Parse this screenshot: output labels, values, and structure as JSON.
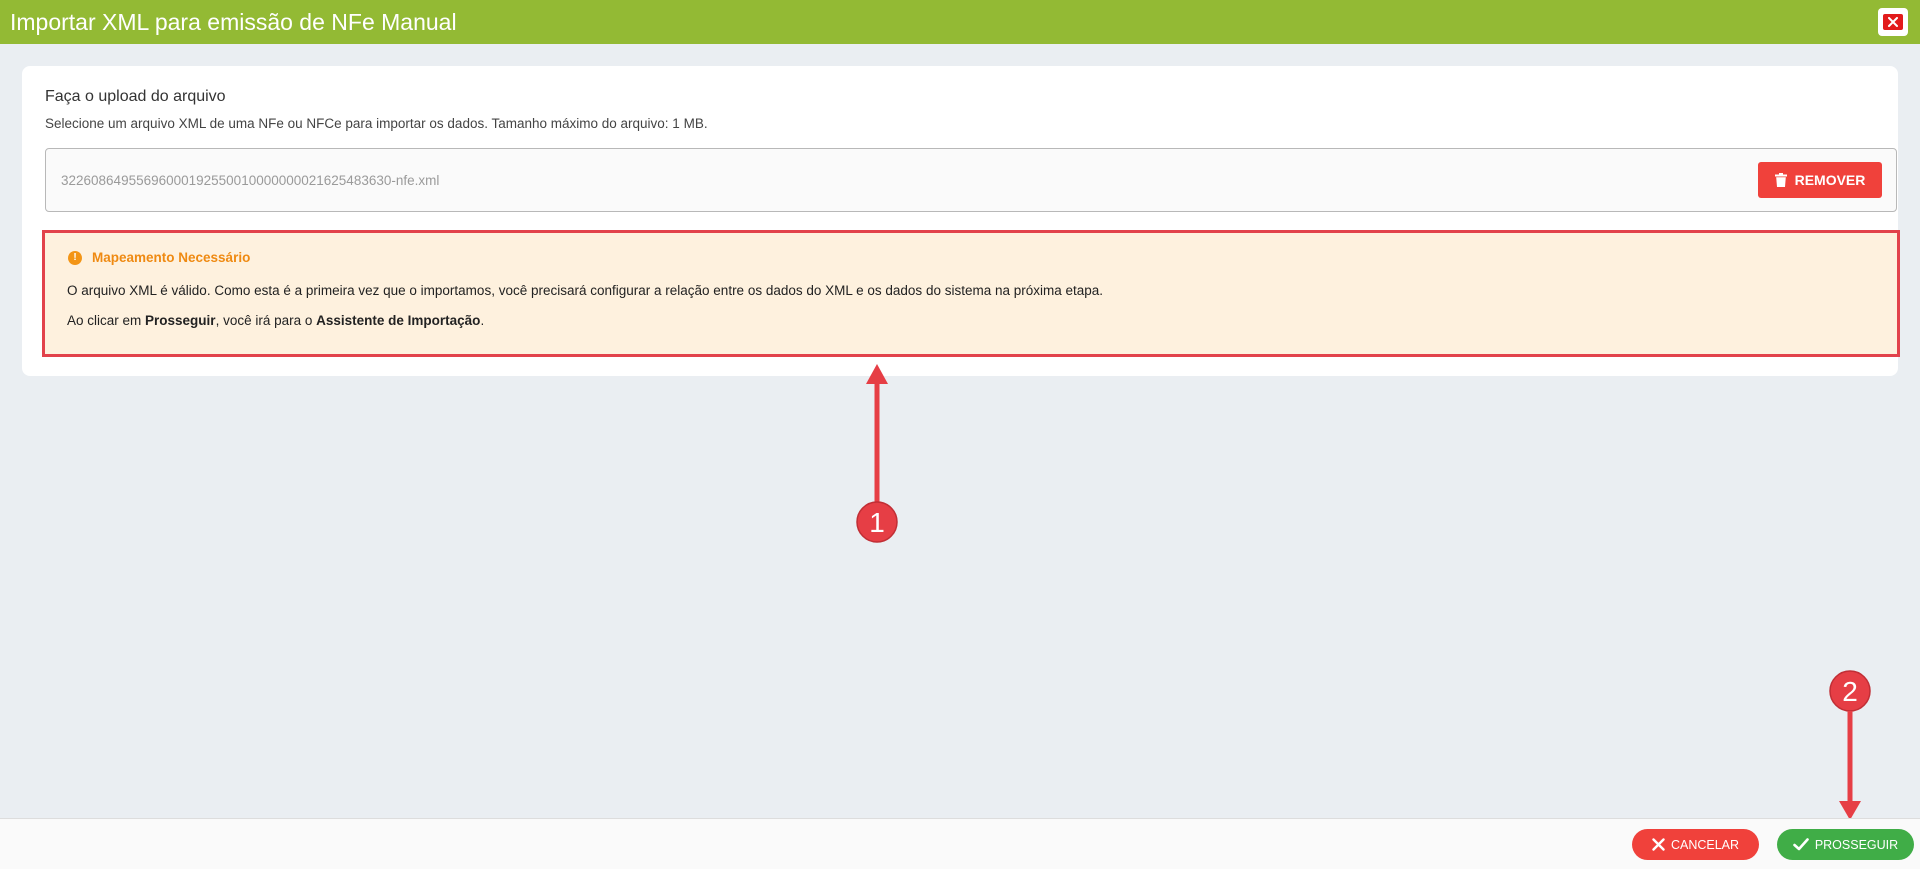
{
  "window": {
    "title": "Importar XML para emissão de NFe Manual",
    "close_icon": "close-icon"
  },
  "upload": {
    "title": "Faça o upload do arquivo",
    "subtitle": "Selecione um arquivo XML de uma NFe ou NFCe para importar os dados. Tamanho máximo do arquivo: 1 MB.",
    "file_name": "32260864955696000192550010000000021625483630-nfe.xml",
    "remove_label": "REMOVER",
    "remove_icon": "trash-icon"
  },
  "alert": {
    "title": "Mapeamento Necessário",
    "icon": "exclamation-icon",
    "line1": "O arquivo XML é válido. Como esta é a primeira vez que o importamos, você precisará configurar a relação entre os dados do XML e os dados do sistema na próxima etapa.",
    "line2_prefix": "Ao clicar em ",
    "line2_bold1": "Prosseguir",
    "line2_middle": ", você irá para o ",
    "line2_bold2": "Assistente de Importação",
    "line2_suffix": "."
  },
  "annotations": {
    "marker1": "1",
    "marker2": "2",
    "color": "#e63e45"
  },
  "footer": {
    "cancel_label": "CANCELAR",
    "proceed_label": "PROSSEGUIR"
  },
  "colors": {
    "titlebar": "#93ba34",
    "danger": "#f0413b",
    "success": "#40ad47",
    "warning_bg": "#fef1de",
    "warning_text": "#ef8a12"
  }
}
